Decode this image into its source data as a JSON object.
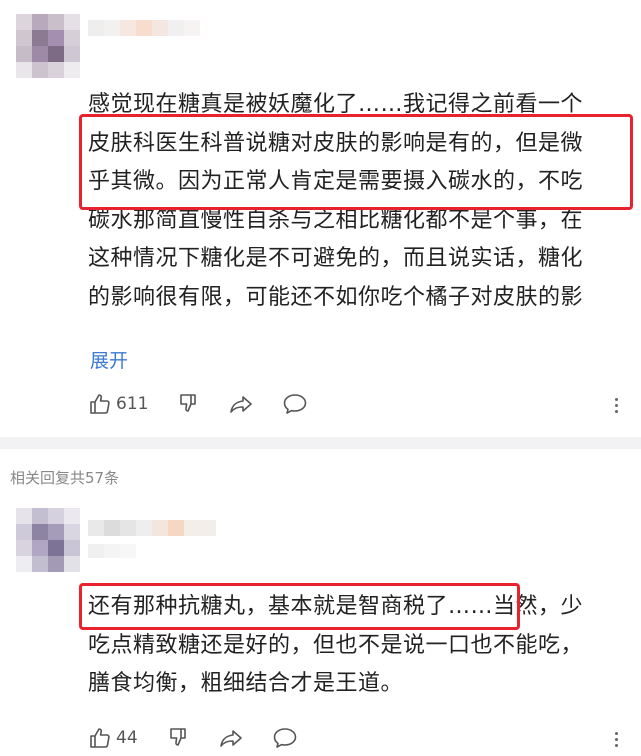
{
  "comments": [
    {
      "lines": [
        "感觉现在糖真是被妖魔化了……我记得之前看一个",
        "皮肤科医生科普说糖对皮肤的影响是有的，但是微",
        "乎其微。因为正常人肯定是需要摄入碳水的，不吃",
        "碳水那简直慢性自杀与之相比糖化都不是个事，在",
        "这种情况下糖化是不可避免的，而且说实话，糖化",
        "的影响很有限，可能还不如你吃个橘子对皮肤的影"
      ],
      "expand_label": "展开",
      "like_count": "611"
    },
    {
      "lines": [
        "还有那种抗糖丸，基本就是智商税了……当然，少",
        "吃点精致糖还是好的，但也不是说一口也不能吃，",
        "膳食均衡，粗细结合才是王道。"
      ],
      "like_count": "44"
    }
  ],
  "replies_header": "相关回复共57条",
  "highlight_color": "#e8232f",
  "link_color": "#3d7bd1",
  "icons": [
    "thumb-up-icon",
    "thumb-down-icon",
    "share-icon",
    "comment-icon",
    "more-icon"
  ]
}
